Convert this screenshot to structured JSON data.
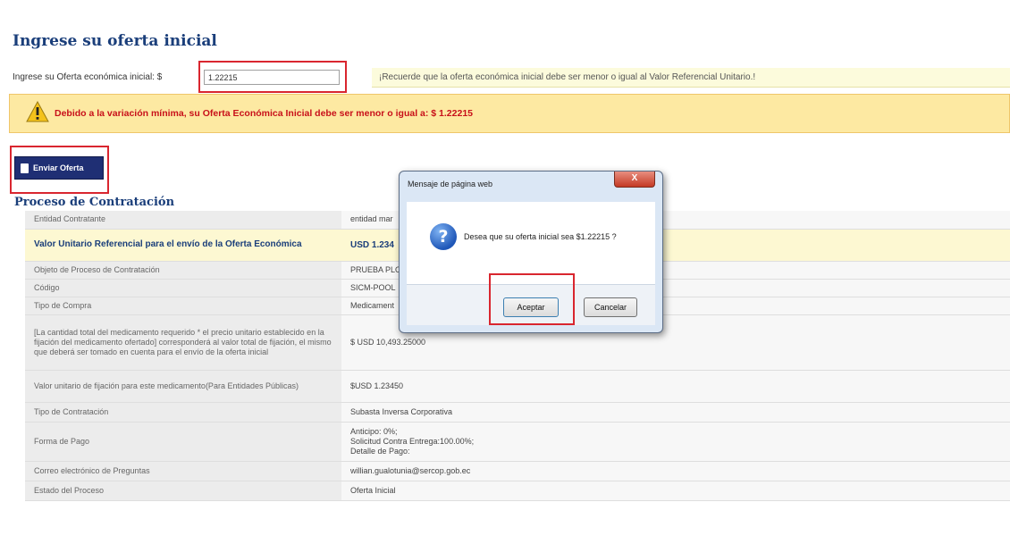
{
  "page": {
    "title": "Ingrese su oferta inicial"
  },
  "offer": {
    "label": "Ingrese su Oferta económica inicial: $",
    "input_value": "1.22215",
    "note": "¡Recuerde que la oferta económica inicial debe ser menor o igual al Valor Referencial Unitario.!"
  },
  "warning": {
    "text": "Debido a la variación mínima, su Oferta Económica Inicial debe ser menor o igual a: $ 1.22215"
  },
  "send_button": {
    "label": "Enviar Oferta"
  },
  "process": {
    "title": "Proceso de Contratación",
    "rows": [
      {
        "label": "Entidad Contratante",
        "value": "entidad mar"
      },
      {
        "label": "Valor Unitario Referencial para el envío de la Oferta Económica",
        "value": "USD 1.234"
      },
      {
        "label": "Objeto de Proceso de Contratación",
        "value": "PRUEBA PLO"
      },
      {
        "label": "Código",
        "value": "SICM-POOL"
      },
      {
        "label": "Tipo de Compra",
        "value": "Medicament"
      },
      {
        "label": "[La cantidad total del medicamento requerido * el precio unitario establecido en la fijación del medicamento ofertado] corresponderá al valor total de fijación, el mismo que deberá ser tomado en cuenta para el envío de la oferta inicial",
        "value": "$ USD 10,493.25000"
      },
      {
        "label": "Valor unitario de fijación para este medicamento(Para Entidades Públicas)",
        "value": "$USD 1.23450"
      },
      {
        "label": "Tipo de Contratación",
        "value": "Subasta Inversa Corporativa"
      },
      {
        "label": "Forma de Pago",
        "value_lines": [
          "Anticipo: 0%;",
          "Solicitud Contra Entrega:100.00%;",
          "Detalle de Pago:"
        ]
      },
      {
        "label": "Correo electrónico de Preguntas",
        "value": "willian.gualotunia@sercop.gob.ec"
      },
      {
        "label": "Estado del Proceso",
        "value": "Oferta Inicial"
      }
    ]
  },
  "dialog": {
    "title": "Mensaje de página web",
    "close_label": "X",
    "message": "Desea que su oferta inicial sea $1.22215 ?",
    "accept_label": "Aceptar",
    "cancel_label": "Cancelar"
  },
  "colors": {
    "title_blue": "#1a3e7a",
    "warning_red": "#c8101a",
    "highlight_red": "#d9262f",
    "button_navy": "#1f2f74"
  }
}
